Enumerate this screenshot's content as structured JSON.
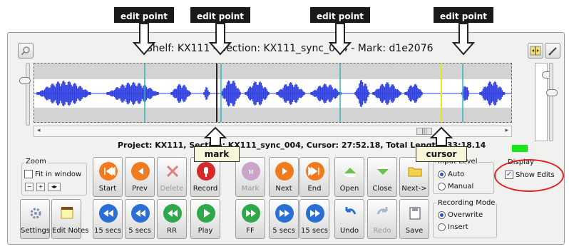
{
  "callouts": {
    "edit_point_1": "edit point",
    "edit_point_2": "edit point",
    "edit_point_3": "edit point",
    "edit_point_4": "edit point",
    "mark": "mark",
    "cursor": "cursor"
  },
  "header": {
    "title": "Shelf: KX111 - Section: KX111_sync_004 - Mark: d1e2076",
    "zoom_tool_icon": "magnifier-icon",
    "right_tool_1": "split-icon",
    "right_tool_2": "pencil-icon"
  },
  "info_line": "Project: KX111, Section: KX111_sync_004, Cursor: 27:52.18, Total Length: 33:18.14",
  "zoom": {
    "label": "Zoom",
    "fit_label": "Fit in window",
    "fit_checked": false,
    "minus": "−",
    "plus": "+",
    "fit_btn": "◂▸"
  },
  "buttons_row1": [
    {
      "label": "Start",
      "icon": "skip-start-icon",
      "color": "#f07a1e",
      "disabled": false
    },
    {
      "label": "Prev",
      "icon": "prev-icon",
      "color": "#f07a1e",
      "disabled": false
    },
    {
      "label": "Delete",
      "icon": "delete-icon",
      "color": "#d9a5a5",
      "disabled": true
    },
    {
      "label": "Record",
      "icon": "record-icon",
      "color": "#d42a2a",
      "disabled": false
    },
    {
      "label": "Mark",
      "icon": "mark-icon",
      "color": "#c9a5c9",
      "disabled": true
    },
    {
      "label": "Next",
      "icon": "next-icon",
      "color": "#f07a1e",
      "disabled": false
    },
    {
      "label": "End",
      "icon": "skip-end-icon",
      "color": "#f07a1e",
      "disabled": false
    },
    {
      "label": "Open",
      "icon": "open-icon",
      "color": "#e8c21a",
      "disabled": false
    },
    {
      "label": "Close",
      "icon": "close-book-icon",
      "color": "#e8c21a",
      "disabled": false
    },
    {
      "label": "Next->",
      "icon": "folder-icon",
      "color": "#e8c21a",
      "disabled": false
    }
  ],
  "buttons_row2": [
    {
      "label": "Settings",
      "icon": "gear-icon",
      "color": "#7f8fa8",
      "disabled": false
    },
    {
      "label": "Edit Notes",
      "icon": "notepad-icon",
      "color": "#e9d35a",
      "disabled": false
    },
    {
      "label": "15 secs",
      "icon": "rewind-icon",
      "color": "#2a6fd6",
      "disabled": false
    },
    {
      "label": "5 secs",
      "icon": "rewind-icon",
      "color": "#2a6fd6",
      "disabled": false
    },
    {
      "label": "RR",
      "icon": "rewind-icon",
      "color": "#2fa84a",
      "disabled": false
    },
    {
      "label": "Play",
      "icon": "play-icon",
      "color": "#2fa84a",
      "disabled": false
    },
    {
      "label": "FF",
      "icon": "fast-forward-icon",
      "color": "#2fa84a",
      "disabled": false
    },
    {
      "label": "5 secs",
      "icon": "fast-forward-icon",
      "color": "#2a6fd6",
      "disabled": false
    },
    {
      "label": "15 secs",
      "icon": "fast-forward-icon",
      "color": "#2a6fd6",
      "disabled": false
    },
    {
      "label": "Undo",
      "icon": "undo-icon",
      "color": "#2a6fd6",
      "disabled": false
    },
    {
      "label": "Redo",
      "icon": "redo-icon",
      "color": "#a9b8d0",
      "disabled": true
    },
    {
      "label": "Save",
      "icon": "save-icon",
      "color": "#7f98c0",
      "disabled": false
    }
  ],
  "input_level": {
    "label": "Input Level",
    "options": [
      "Auto",
      "Manual"
    ],
    "selected": "Auto"
  },
  "recording_mode": {
    "label": "Recording Mode",
    "options": [
      "Overwrite",
      "Insert"
    ],
    "selected": "Overwrite"
  },
  "display": {
    "label": "Display",
    "show_edits": "Show Edits",
    "show_edits_checked": true
  },
  "colors": {
    "waveform": "#2f3fe0",
    "edit_line": "#2fb8b8",
    "cursor_line": "#e6e61a",
    "mark_line": "#111111",
    "highlight": "#e02020",
    "level_green": "#19e619"
  }
}
